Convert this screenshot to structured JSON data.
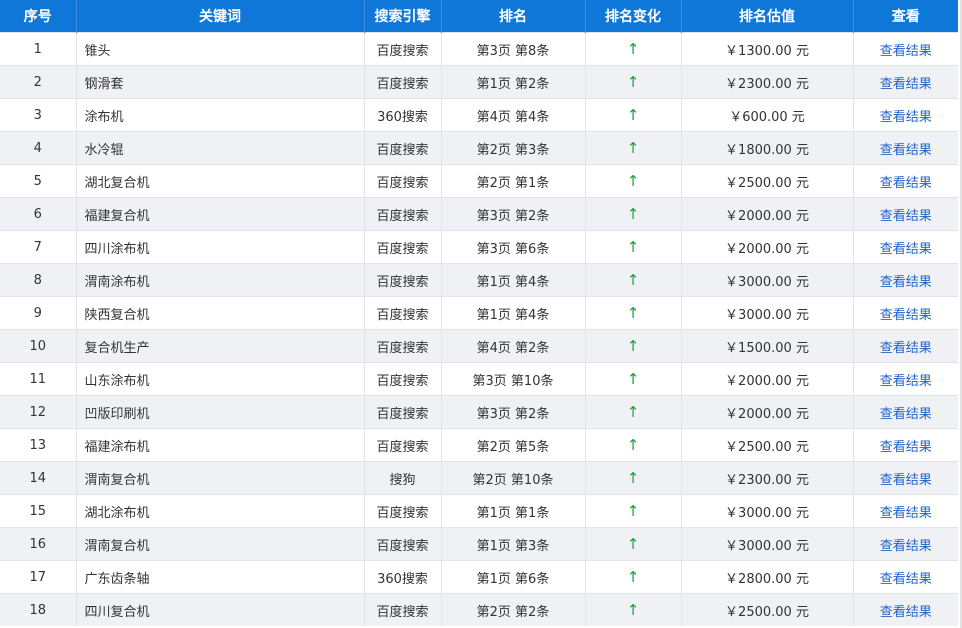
{
  "table": {
    "headers": [
      "序号",
      "关键词",
      "搜索引擎",
      "排名",
      "排名变化",
      "排名估值",
      "查看"
    ],
    "change_color": "#1ea03a",
    "header_bg": "#0f77d8",
    "link_color": "#1f63c9",
    "rows": [
      {
        "no": "1",
        "keyword": "锥头",
        "engine": "百度搜索",
        "rank": "第3页 第8条",
        "change": "↑",
        "value": "￥1300.00 元",
        "view": "查看结果"
      },
      {
        "no": "2",
        "keyword": "钢滑套",
        "engine": "百度搜索",
        "rank": "第1页 第2条",
        "change": "↑",
        "value": "￥2300.00 元",
        "view": "查看结果"
      },
      {
        "no": "3",
        "keyword": "涂布机",
        "engine": "360搜索",
        "rank": "第4页 第4条",
        "change": "↑",
        "value": "￥600.00 元",
        "view": "查看结果"
      },
      {
        "no": "4",
        "keyword": "水冷辊",
        "engine": "百度搜索",
        "rank": "第2页 第3条",
        "change": "↑",
        "value": "￥1800.00 元",
        "view": "查看结果"
      },
      {
        "no": "5",
        "keyword": "湖北复合机",
        "engine": "百度搜索",
        "rank": "第2页 第1条",
        "change": "↑",
        "value": "￥2500.00 元",
        "view": "查看结果"
      },
      {
        "no": "6",
        "keyword": "福建复合机",
        "engine": "百度搜索",
        "rank": "第3页 第2条",
        "change": "↑",
        "value": "￥2000.00 元",
        "view": "查看结果"
      },
      {
        "no": "7",
        "keyword": "四川涂布机",
        "engine": "百度搜索",
        "rank": "第3页 第6条",
        "change": "↑",
        "value": "￥2000.00 元",
        "view": "查看结果"
      },
      {
        "no": "8",
        "keyword": "渭南涂布机",
        "engine": "百度搜索",
        "rank": "第1页 第4条",
        "change": "↑",
        "value": "￥3000.00 元",
        "view": "查看结果"
      },
      {
        "no": "9",
        "keyword": "陕西复合机",
        "engine": "百度搜索",
        "rank": "第1页 第4条",
        "change": "↑",
        "value": "￥3000.00 元",
        "view": "查看结果"
      },
      {
        "no": "10",
        "keyword": "复合机生产",
        "engine": "百度搜索",
        "rank": "第4页 第2条",
        "change": "↑",
        "value": "￥1500.00 元",
        "view": "查看结果"
      },
      {
        "no": "11",
        "keyword": "山东涂布机",
        "engine": "百度搜索",
        "rank": "第3页 第10条",
        "change": "↑",
        "value": "￥2000.00 元",
        "view": "查看结果"
      },
      {
        "no": "12",
        "keyword": "凹版印刷机",
        "engine": "百度搜索",
        "rank": "第3页 第2条",
        "change": "↑",
        "value": "￥2000.00 元",
        "view": "查看结果"
      },
      {
        "no": "13",
        "keyword": "福建涂布机",
        "engine": "百度搜索",
        "rank": "第2页 第5条",
        "change": "↑",
        "value": "￥2500.00 元",
        "view": "查看结果"
      },
      {
        "no": "14",
        "keyword": "渭南复合机",
        "engine": "搜狗",
        "rank": "第2页 第10条",
        "change": "↑",
        "value": "￥2300.00 元",
        "view": "查看结果"
      },
      {
        "no": "15",
        "keyword": "湖北涂布机",
        "engine": "百度搜索",
        "rank": "第1页 第1条",
        "change": "↑",
        "value": "￥3000.00 元",
        "view": "查看结果"
      },
      {
        "no": "16",
        "keyword": "渭南复合机",
        "engine": "百度搜索",
        "rank": "第1页 第3条",
        "change": "↑",
        "value": "￥3000.00 元",
        "view": "查看结果"
      },
      {
        "no": "17",
        "keyword": "广东齿条轴",
        "engine": "360搜索",
        "rank": "第1页 第6条",
        "change": "↑",
        "value": "￥2800.00 元",
        "view": "查看结果"
      },
      {
        "no": "18",
        "keyword": "四川复合机",
        "engine": "百度搜索",
        "rank": "第2页 第2条",
        "change": "↑",
        "value": "￥2500.00 元",
        "view": "查看结果"
      }
    ]
  }
}
